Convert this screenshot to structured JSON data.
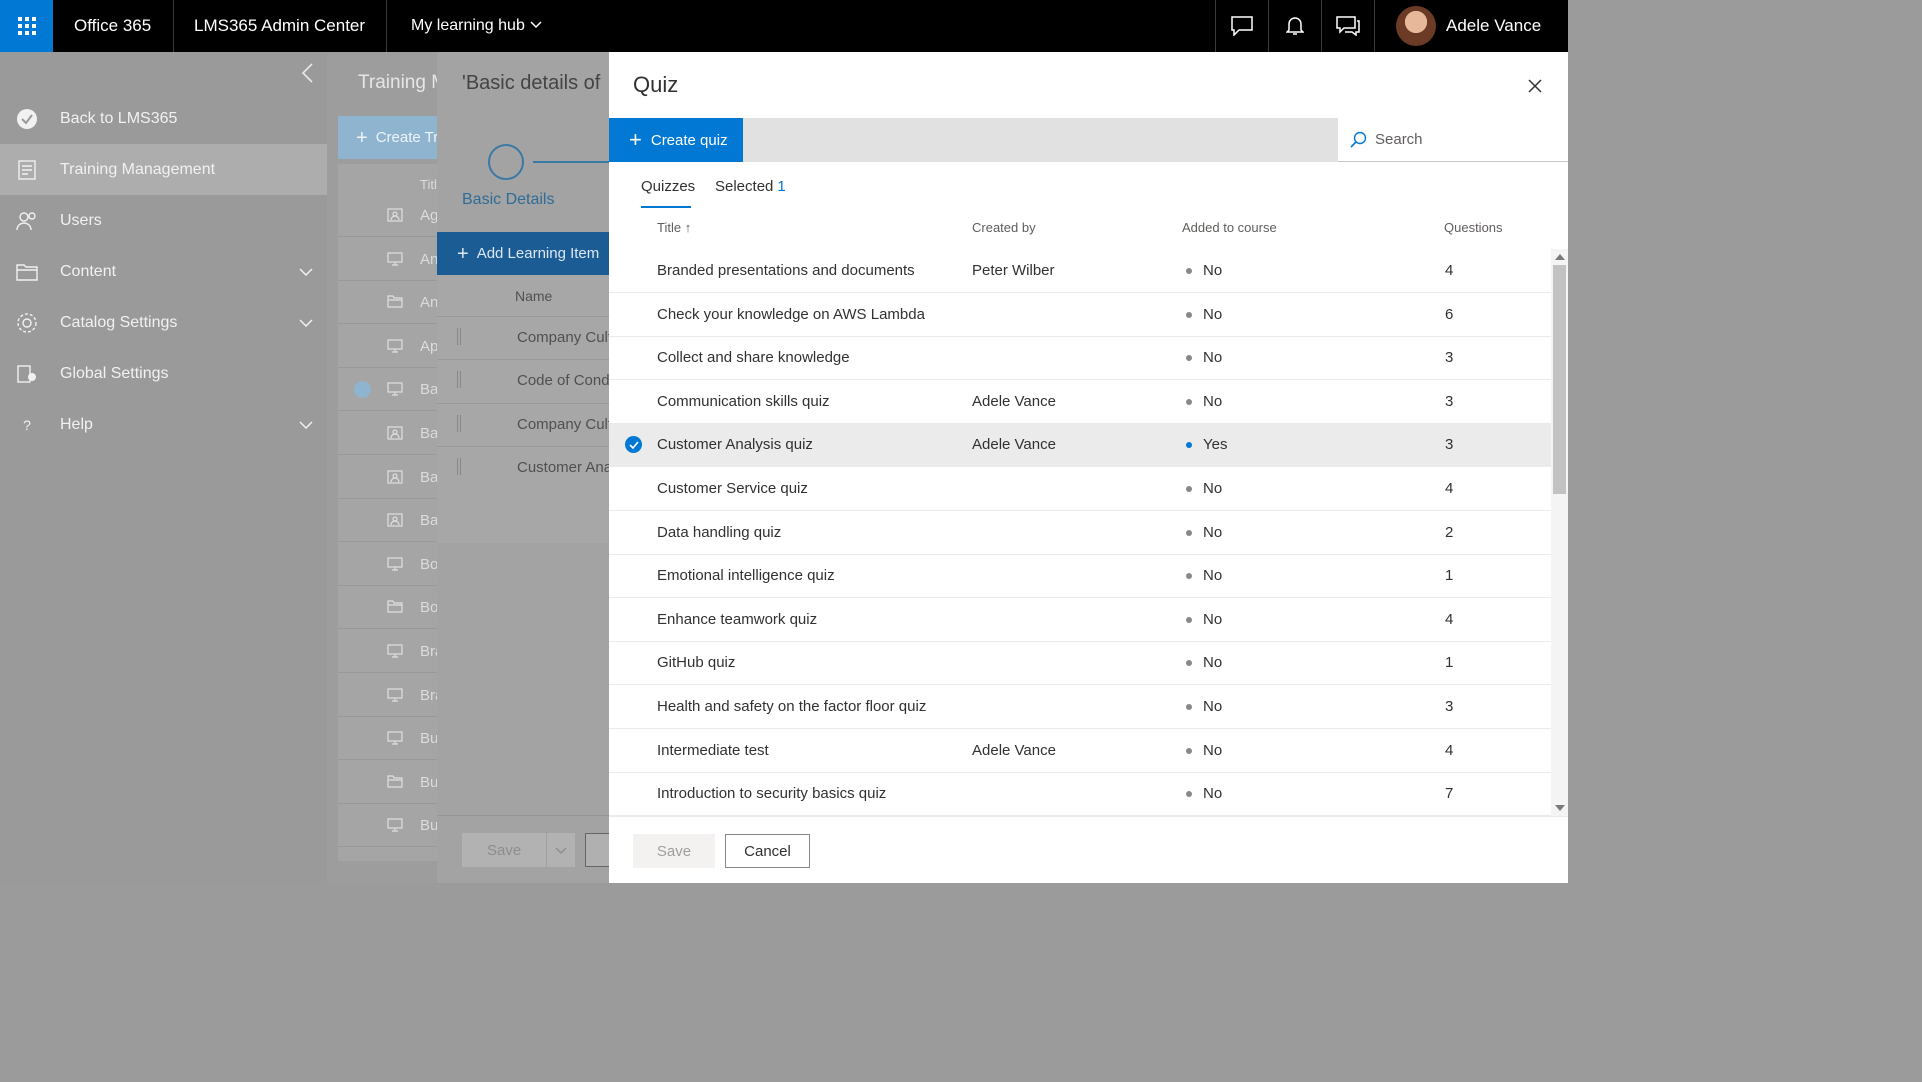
{
  "topbar": {
    "product": "Office 365",
    "admin_center": "LMS365 Admin Center",
    "hub": "My learning hub",
    "user_name": "Adele Vance",
    "accent": "#0078d4"
  },
  "leftnav": {
    "items": [
      {
        "label": "Back to LMS365",
        "icon": "check-circle-icon"
      },
      {
        "label": "Training Management",
        "icon": "report-icon",
        "active": true
      },
      {
        "label": "Users",
        "icon": "users-icon"
      },
      {
        "label": "Content",
        "icon": "folder-icon",
        "expandable": true
      },
      {
        "label": "Catalog Settings",
        "icon": "gear-icon",
        "expandable": true
      },
      {
        "label": "Global Settings",
        "icon": "settings-doc-icon"
      },
      {
        "label": "Help",
        "icon": "question-icon",
        "expandable": true
      }
    ]
  },
  "training": {
    "title": "Training M",
    "create_label": "Create Tr",
    "col_title": "Titl",
    "rows": [
      {
        "text": "Ag",
        "icon": "person-card-icon"
      },
      {
        "text": "An",
        "icon": "monitor-icon"
      },
      {
        "text": "An",
        "icon": "folder-icon"
      },
      {
        "text": "Ap",
        "icon": "monitor-icon"
      },
      {
        "text": "Ba",
        "icon": "monitor-icon",
        "checked": true
      },
      {
        "text": "Ba",
        "icon": "person-card-icon"
      },
      {
        "text": "Ba",
        "icon": "person-card-icon"
      },
      {
        "text": "Ba",
        "icon": "person-card-icon"
      },
      {
        "text": "Bo",
        "icon": "monitor-icon"
      },
      {
        "text": "Bo",
        "icon": "folder-icon"
      },
      {
        "text": "Bra",
        "icon": "monitor-icon"
      },
      {
        "text": "Bra",
        "icon": "monitor-icon"
      },
      {
        "text": "Bu",
        "icon": "monitor-icon"
      },
      {
        "text": "Bu",
        "icon": "folder-icon"
      },
      {
        "text": "Bu",
        "icon": "monitor-icon"
      }
    ]
  },
  "basic": {
    "title": "'Basic details of",
    "step_label": "Basic Details",
    "add_label": "Add Learning Item",
    "col_name": "Name",
    "rows": [
      "Company Cultu",
      "Code of Condu",
      "Company Cultu",
      "Customer Anal"
    ],
    "save_label": "Save"
  },
  "quiz": {
    "title": "Quiz",
    "create_label": "Create quiz",
    "search_placeholder": "Search",
    "tabs": {
      "quizzes": "Quizzes",
      "selected": "Selected",
      "selected_count": "1"
    },
    "columns": {
      "title": "Title",
      "created_by": "Created by",
      "added": "Added to course",
      "questions": "Questions"
    },
    "rows": [
      {
        "title": "Branded presentations and documents",
        "created_by": "Peter Wilber",
        "added": "No",
        "questions": "4"
      },
      {
        "title": "Check your knowledge on AWS Lambda",
        "created_by": "",
        "added": "No",
        "questions": "6"
      },
      {
        "title": "Collect and share knowledge",
        "created_by": "",
        "added": "No",
        "questions": "3"
      },
      {
        "title": "Communication skills quiz",
        "created_by": "Adele Vance",
        "added": "No",
        "questions": "3"
      },
      {
        "title": "Customer Analysis quiz",
        "created_by": "Adele Vance",
        "added": "Yes",
        "questions": "3",
        "selected": true
      },
      {
        "title": "Customer Service quiz",
        "created_by": "",
        "added": "No",
        "questions": "4"
      },
      {
        "title": "Data handling quiz",
        "created_by": "",
        "added": "No",
        "questions": "2"
      },
      {
        "title": "Emotional intelligence quiz",
        "created_by": "",
        "added": "No",
        "questions": "1"
      },
      {
        "title": "Enhance teamwork quiz",
        "created_by": "",
        "added": "No",
        "questions": "4"
      },
      {
        "title": "GitHub quiz",
        "created_by": "",
        "added": "No",
        "questions": "1"
      },
      {
        "title": "Health and safety on the factor floor quiz",
        "created_by": "",
        "added": "No",
        "questions": "3"
      },
      {
        "title": "Intermediate test",
        "created_by": "Adele Vance",
        "added": "No",
        "questions": "4"
      },
      {
        "title": "Introduction to security basics quiz",
        "created_by": "",
        "added": "No",
        "questions": "7"
      }
    ],
    "save_label": "Save",
    "cancel_label": "Cancel"
  }
}
